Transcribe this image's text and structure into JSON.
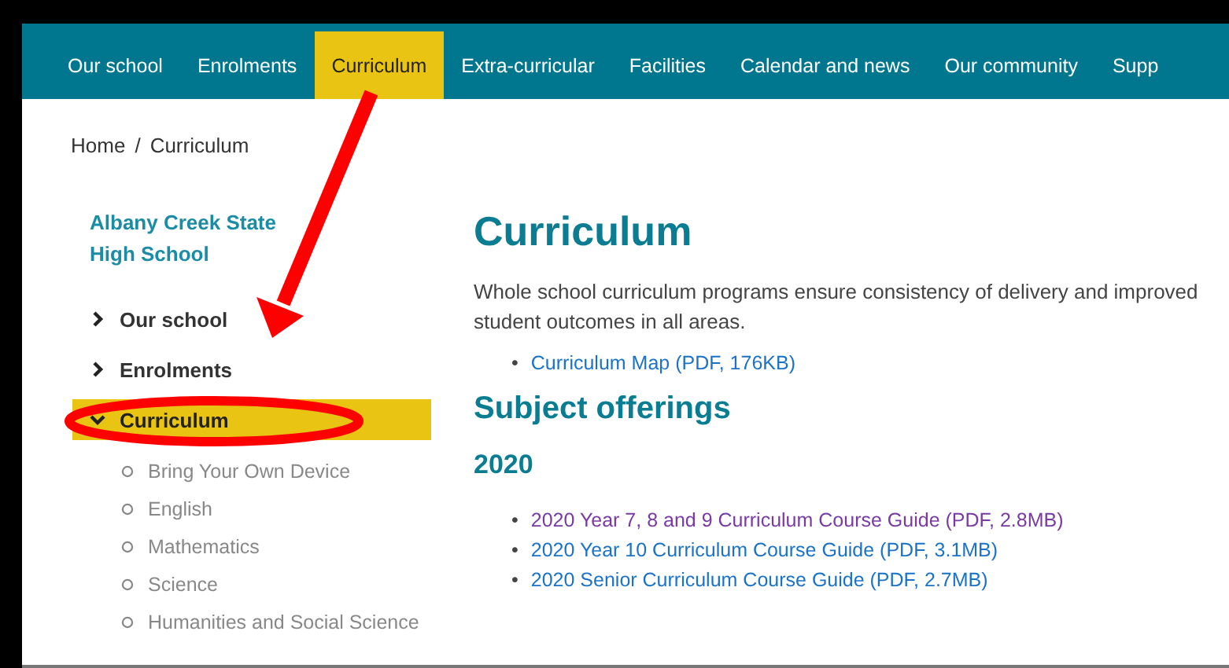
{
  "nav": [
    {
      "label": "Our school",
      "selected": false
    },
    {
      "label": "Enrolments",
      "selected": false
    },
    {
      "label": "Curriculum",
      "selected": true
    },
    {
      "label": "Extra-curricular",
      "selected": false
    },
    {
      "label": "Facilities",
      "selected": false
    },
    {
      "label": "Calendar and news",
      "selected": false
    },
    {
      "label": "Our community",
      "selected": false
    },
    {
      "label": "Supp",
      "selected": false
    }
  ],
  "breadcrumb": [
    "Home",
    "Curriculum"
  ],
  "breadcrumb_separator": "/",
  "sidebar": {
    "title": "Albany Creek State High School",
    "items": [
      {
        "label": "Our school",
        "expanded": false,
        "selected": false
      },
      {
        "label": "Enrolments",
        "expanded": false,
        "selected": false
      },
      {
        "label": "Curriculum",
        "expanded": true,
        "selected": true,
        "children": [
          {
            "label": "Bring Your Own Device"
          },
          {
            "label": "English"
          },
          {
            "label": "Mathematics"
          },
          {
            "label": "Science"
          },
          {
            "label": "Humanities and Social Science"
          }
        ]
      }
    ]
  },
  "content": {
    "title": "Curriculum",
    "intro": "Whole school curriculum programs ensure consistency of delivery and improved student outcomes in all areas.",
    "bullet": "•",
    "links": [
      {
        "label": "Curriculum Map (PDF, 176KB)",
        "visited": false
      }
    ],
    "section_title": "Subject offerings",
    "year": "2020",
    "year_links": [
      {
        "label": "2020 Year 7, 8 and 9 Curriculum Course Guide (PDF, 2.8MB)",
        "visited": true
      },
      {
        "label": "2020 Year 10 Curriculum Course Guide (PDF, 3.1MB)",
        "visited": false
      },
      {
        "label": "2020 Senior Curriculum Course Guide (PDF, 2.7MB)",
        "visited": false
      }
    ]
  }
}
